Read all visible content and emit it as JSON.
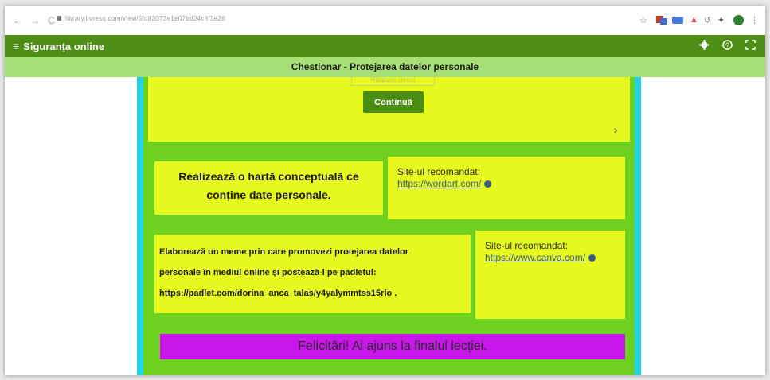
{
  "browser": {
    "nav": [
      "←",
      "→",
      "C"
    ],
    "url": "library.livresq.com/view/5fd83073e1e07bd24c8f3e26"
  },
  "app": {
    "title": "Siguranța online",
    "icons": [
      "gear-icon",
      "help-icon",
      "fullscreen-icon"
    ]
  },
  "subheader": {
    "title": "Chestionar - Protejarea datelor personale"
  },
  "quiz": {
    "ghost_label": "Răspuns corect",
    "continue_label": "Continuă",
    "next": "›"
  },
  "tasks": [
    {
      "lines": [
        "Realizează o hartă conceptuală ce",
        "conține date personale."
      ],
      "site_label": "Site-ul recomandat:",
      "site_link": "https://wordart.com/"
    },
    {
      "lines": [
        "Elaborează un meme prin care promovezi protejarea datelor",
        "personale în mediul online și postează-l pe padletul:",
        "https://padlet.com/dorina_anca_talas/y4yalymmtss15rlo ."
      ],
      "site_label": "Site-ul recomandat:",
      "site_link": "https://www.canva.com/"
    }
  ],
  "final_message": "Felicitări! Ai ajuns la finalul lecției.",
  "colors": {
    "header": "#4e8d16",
    "subheader": "#a6df76",
    "panel": "#6fd11f",
    "card": "#e7fa1f",
    "border": "#22d3e6",
    "final": "#c816ea"
  }
}
